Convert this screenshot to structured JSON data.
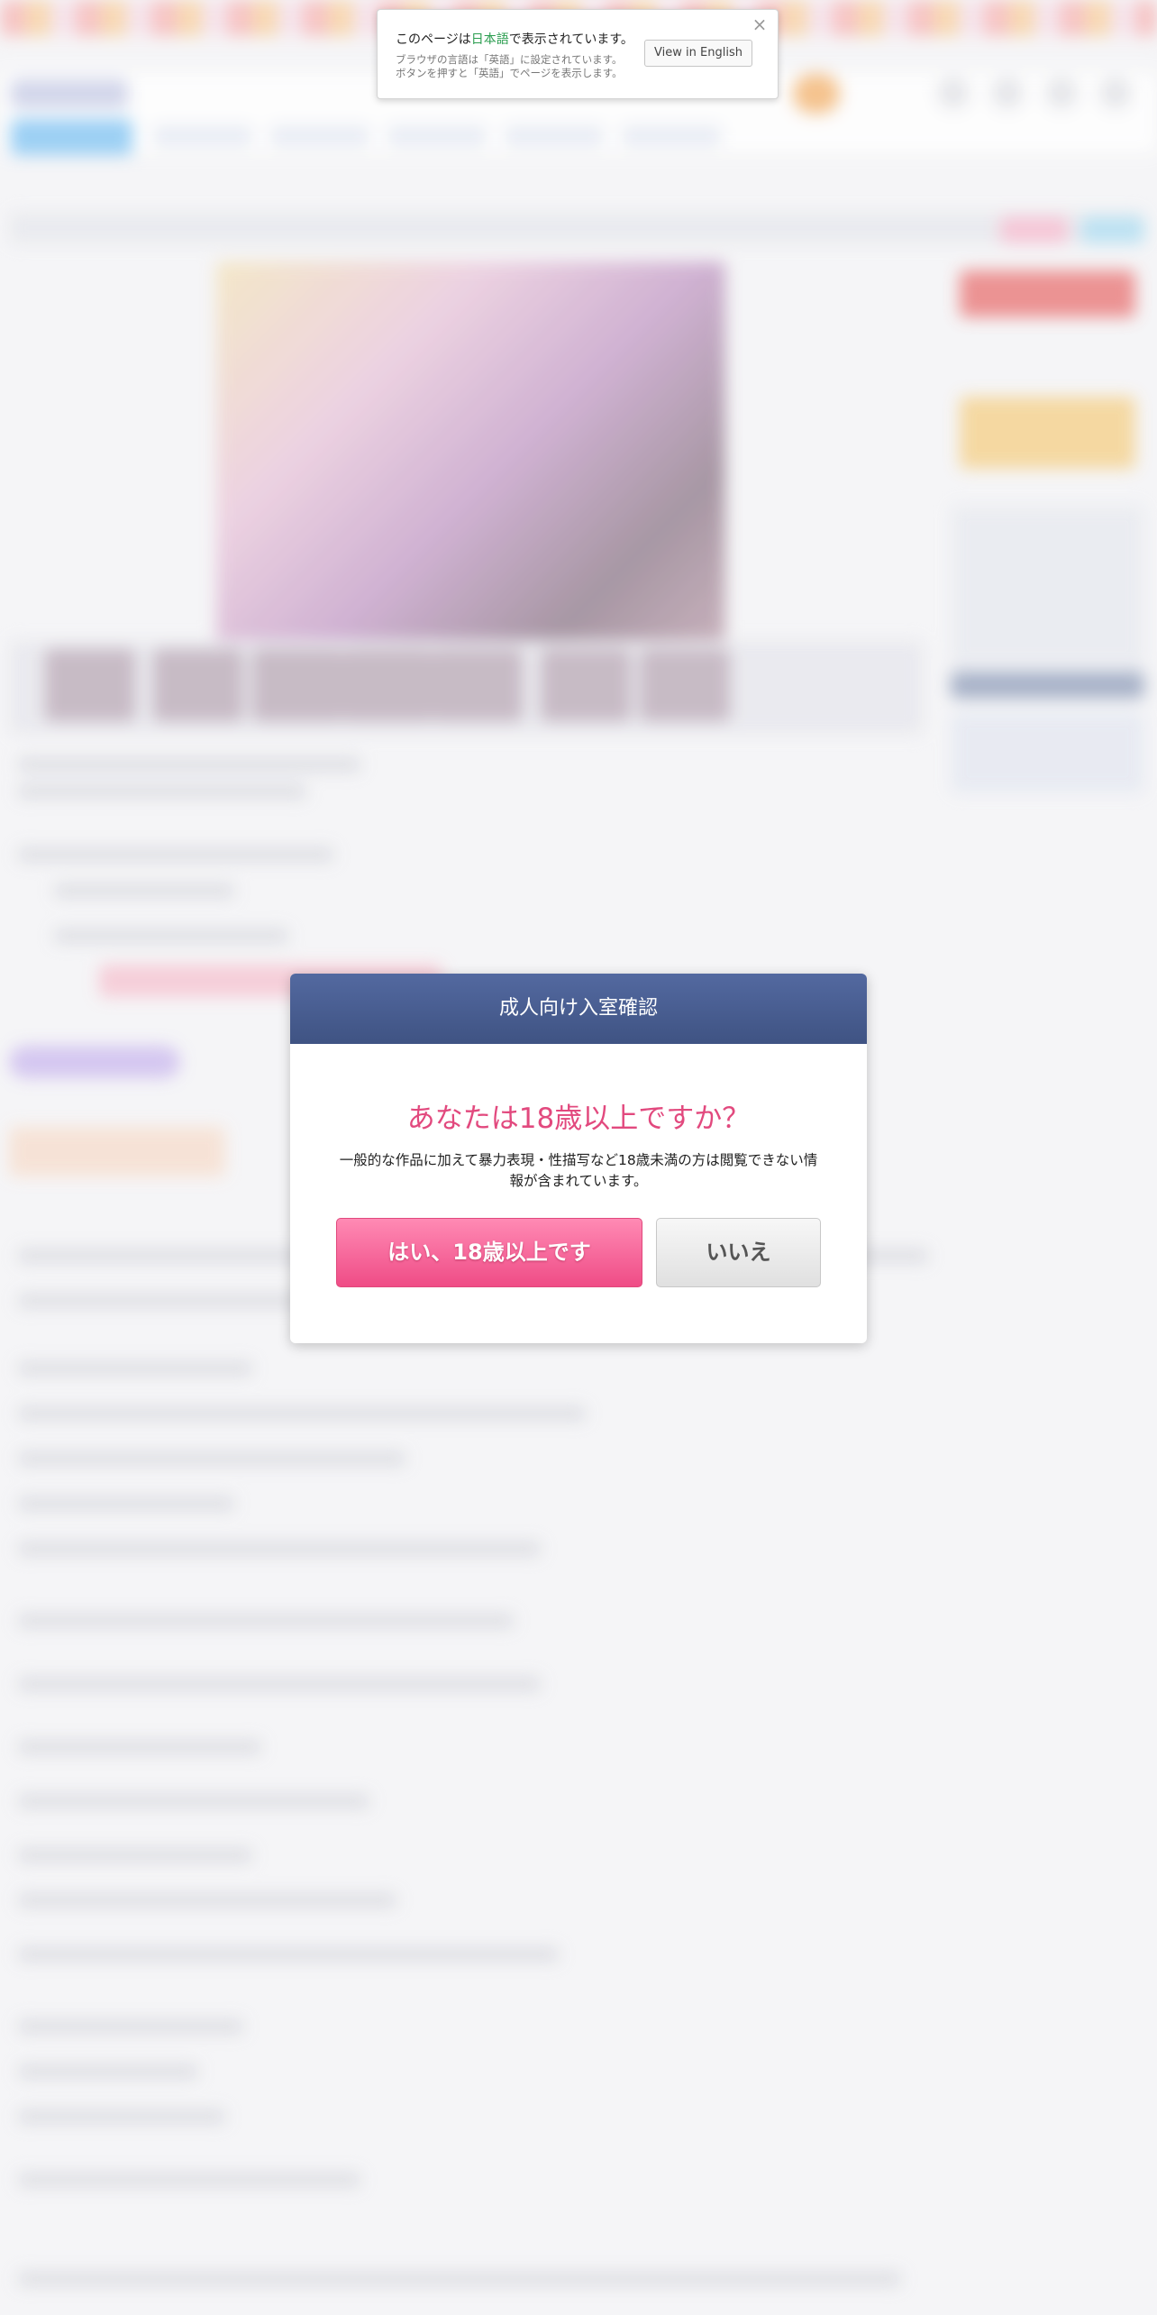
{
  "language_notice": {
    "prefix": "このページは",
    "language": "日本語",
    "suffix": "で表示されています。",
    "sub_line_1": "ブラウザの言語は「英語」に設定されています。",
    "sub_line_2": "ボタンを押すと「英語」でページを表示します。",
    "button_label": "View in English",
    "close_glyph": "×"
  },
  "age_modal": {
    "title": "成人向け入室確認",
    "question": "あなたは18歳以上ですか？",
    "description": "一般的な作品に加えて暴力表現・性描写など18歳未満の方は閲覧できない情報が含まれています。",
    "yes_label": "はい、18歳以上です",
    "no_label": "いいえ"
  },
  "colors": {
    "modal_header": "#3f5383",
    "question_pink": "#e2497e",
    "yes_button": "#ef4c86",
    "highlight_green": "#2a9d4f"
  }
}
